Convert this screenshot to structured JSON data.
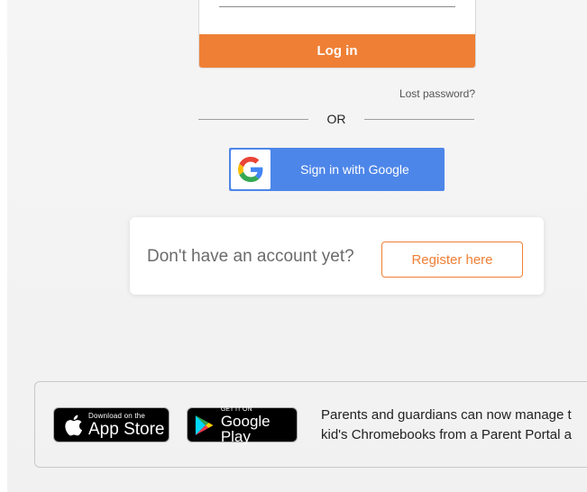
{
  "login": {
    "button_label": "Log in",
    "lost_password": "Lost password?",
    "or_label": "OR",
    "google_button": "Sign in with Google"
  },
  "register": {
    "prompt": "Don't have an account yet?",
    "button_label": "Register here"
  },
  "apps": {
    "app_store_small": "Download on the",
    "app_store_big": "App Store",
    "google_play_small": "GET IT ON",
    "google_play_big": "Google Play",
    "portal_line1": "Parents and guardians can now manage t",
    "portal_line2": "kid's Chromebooks from a Parent Portal a"
  },
  "colors": {
    "accent": "#ef7f35",
    "google_blue": "#4d86e9",
    "background": "#f3f3f3"
  },
  "icons": [
    "apple-icon",
    "google-play-icon",
    "google-g-icon"
  ]
}
